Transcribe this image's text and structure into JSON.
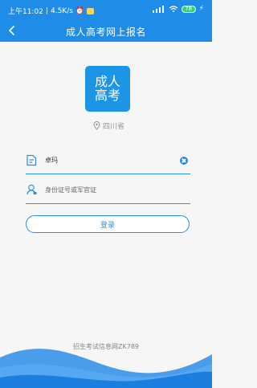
{
  "status_bar": {
    "time": "上午11:02",
    "speed": "4.5K/s",
    "battery": "78"
  },
  "header": {
    "title": "成人高考网上报名"
  },
  "logo": {
    "line1": "成人",
    "line2": "高考"
  },
  "location": {
    "label": "四川省"
  },
  "form": {
    "name_value": "卓玛",
    "id_placeholder": "身份证号或军官证"
  },
  "actions": {
    "login_label": "登录"
  },
  "footer": {
    "text": "招生考试信息网ZK789"
  },
  "colors": {
    "primary": "#1f8de8",
    "text_muted": "#8d95a0"
  },
  "icons": {
    "back": "chevron-left-icon",
    "location": "location-pin-icon",
    "document": "document-icon",
    "user": "user-icon",
    "clear": "clear-icon"
  }
}
